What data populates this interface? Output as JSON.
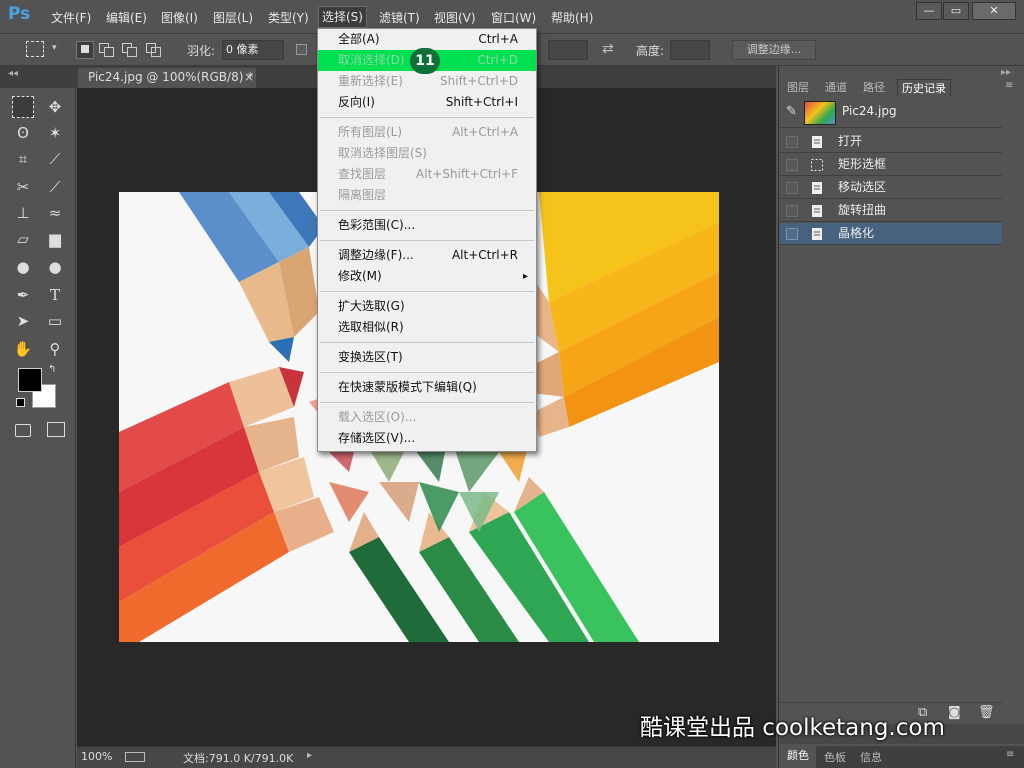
{
  "app": {
    "logo": "Ps"
  },
  "menubar": {
    "items": [
      "文件(F)",
      "编辑(E)",
      "图像(I)",
      "图层(L)",
      "类型(Y)",
      "选择(S)",
      "滤镜(T)",
      "视图(V)",
      "窗口(W)",
      "帮助(H)"
    ],
    "active": "选择(S)"
  },
  "window_controls": {
    "minimize": "—",
    "restore": "▭",
    "close": "✕"
  },
  "options": {
    "feather_label": "羽化:",
    "feather_value": "0 像素",
    "height_label": "高度:",
    "refine_edge_button": "调整边缘..."
  },
  "document": {
    "tab_title": "Pic24.jpg @ 100%(RGB/8) *",
    "close": "×"
  },
  "select_menu": {
    "items": [
      {
        "label": "全部(A)",
        "shortcut": "Ctrl+A",
        "disabled": false
      },
      {
        "label": "取消选择(D)",
        "shortcut": "Ctrl+D",
        "disabled": false,
        "highlighted": true
      },
      {
        "label": "重新选择(E)",
        "shortcut": "Shift+Ctrl+D",
        "disabled": true
      },
      {
        "label": "反向(I)",
        "shortcut": "Shift+Ctrl+I",
        "disabled": false
      },
      {
        "label": "所有图层(L)",
        "shortcut": "Alt+Ctrl+A",
        "disabled": true
      },
      {
        "label": "取消选择图层(S)",
        "shortcut": "",
        "disabled": true
      },
      {
        "label": "查找图层",
        "shortcut": "Alt+Shift+Ctrl+F",
        "disabled": true
      },
      {
        "label": "隔离图层",
        "shortcut": "",
        "disabled": true
      },
      {
        "label": "色彩范围(C)...",
        "shortcut": "",
        "disabled": false
      },
      {
        "label": "调整边缘(F)...",
        "shortcut": "Alt+Ctrl+R",
        "disabled": false
      },
      {
        "label": "修改(M)",
        "shortcut": "▸",
        "disabled": false
      },
      {
        "label": "扩大选取(G)",
        "shortcut": "",
        "disabled": false
      },
      {
        "label": "选取相似(R)",
        "shortcut": "",
        "disabled": false
      },
      {
        "label": "变换选区(T)",
        "shortcut": "",
        "disabled": false
      },
      {
        "label": "在快速蒙版模式下编辑(Q)",
        "shortcut": "",
        "disabled": false
      },
      {
        "label": "载入选区(O)...",
        "shortcut": "",
        "disabled": true
      },
      {
        "label": "存储选区(V)...",
        "shortcut": "",
        "disabled": false
      }
    ]
  },
  "step_badge": "11",
  "panels": {
    "tabs": [
      "图层",
      "通道",
      "路径",
      "历史记录"
    ],
    "active_tab": "历史记录",
    "snapshot_name": "Pic24.jpg",
    "history": [
      {
        "label": "打开",
        "selected": false
      },
      {
        "label": "矩形选框",
        "selected": false
      },
      {
        "label": "移动选区",
        "selected": false
      },
      {
        "label": "旋转扭曲",
        "selected": false
      },
      {
        "label": "晶格化",
        "selected": true
      }
    ],
    "bottom_tabs": [
      "颜色",
      "色板",
      "信息"
    ]
  },
  "status": {
    "zoom": "100%",
    "doc_info": "文档:791.0 K/791.0K"
  },
  "watermark": "酷课堂出品 coolketang.com",
  "colors": {
    "highlight": "#00e051",
    "history_selected": "#46627e",
    "canvas_bg": "#282828"
  }
}
